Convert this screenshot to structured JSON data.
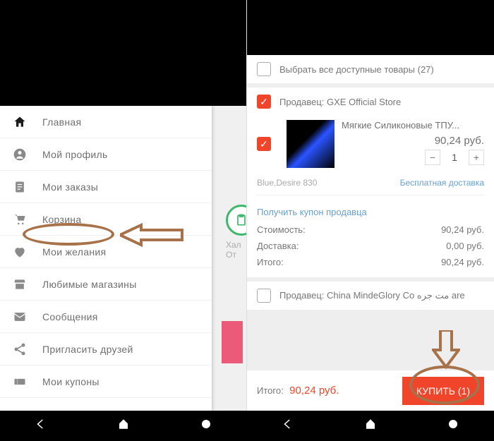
{
  "left": {
    "menu": [
      {
        "icon": "home",
        "label": "Главная"
      },
      {
        "icon": "person",
        "label": "Мой профиль"
      },
      {
        "icon": "clipboard",
        "label": "Мои заказы"
      },
      {
        "icon": "cart",
        "label": "Корзина"
      },
      {
        "icon": "heart",
        "label": "Мои желания"
      },
      {
        "icon": "store",
        "label": "Любимые магазины"
      },
      {
        "icon": "mail",
        "label": "Сообщения"
      },
      {
        "icon": "share",
        "label": "Пригласить друзей"
      },
      {
        "icon": "coupon",
        "label": "Мои купоны"
      }
    ],
    "peek_label_1": "Хал",
    "peek_label_2": "От"
  },
  "right": {
    "select_all": "Выбрать все доступные товары (27)",
    "seller1_line": "Продавец: GXE Official Store",
    "item_title": "Мягкие Силиконовые ТПУ...",
    "item_price": "90,24 руб.",
    "qty": "1",
    "variant": "Blue,Desire 830",
    "freeship": "Бесплатная доставка",
    "coupon": "Получить купон продавца",
    "sum_cost_label": "Стоимость:",
    "sum_cost_val": "90,24 руб.",
    "sum_ship_label": "Доставка:",
    "sum_ship_val": "0,00 руб.",
    "sum_total_label": "Итого:",
    "sum_total_val": "90,24 руб.",
    "seller2_line": "Продавец: China MindeGlory Co مت جره are",
    "footer_label": "Итого:",
    "footer_total": "90,24 руб.",
    "buy_btn": "КУПИТЬ (1)"
  }
}
